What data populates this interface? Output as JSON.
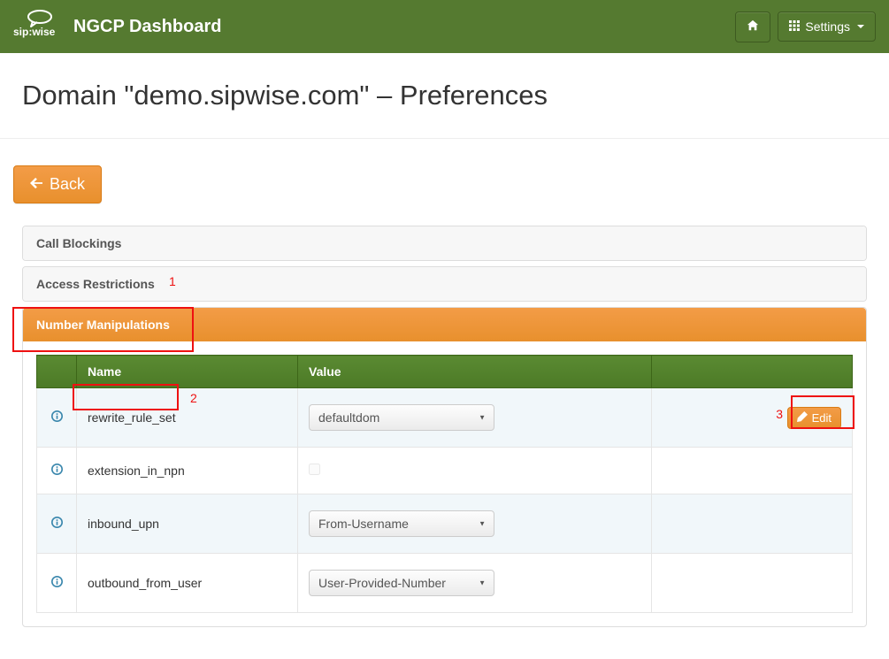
{
  "header": {
    "brand_text": "NGCP Dashboard",
    "settings_label": "Settings"
  },
  "page": {
    "title": "Domain \"demo.sipwise.com\" – Preferences",
    "back_label": "Back"
  },
  "panels": [
    {
      "id": "call-blockings",
      "label": "Call Blockings",
      "active": false
    },
    {
      "id": "access-restrictions",
      "label": "Access Restrictions",
      "active": false
    },
    {
      "id": "number-manipulations",
      "label": "Number Manipulations",
      "active": true
    }
  ],
  "table": {
    "columns": {
      "name": "Name",
      "value": "Value"
    },
    "rows": [
      {
        "name": "rewrite_rule_set",
        "type": "select",
        "value": "defaultdom",
        "edit_label": "Edit"
      },
      {
        "name": "extension_in_npn",
        "type": "checkbox",
        "checked": false
      },
      {
        "name": "inbound_upn",
        "type": "select",
        "value": "From-Username"
      },
      {
        "name": "outbound_from_user",
        "type": "select",
        "value": "User-Provided-Number"
      }
    ]
  },
  "annotations": {
    "a1": "1",
    "a2": "2",
    "a3": "3"
  }
}
